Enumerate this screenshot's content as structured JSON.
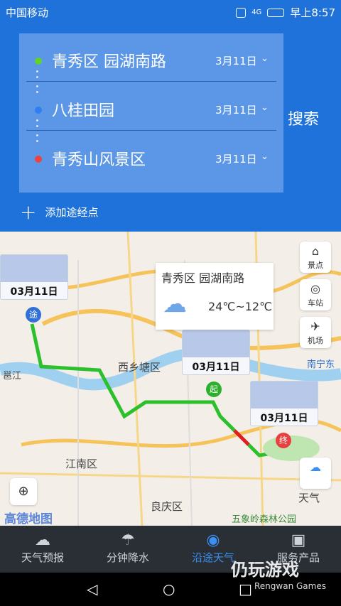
{
  "status_bar": {
    "carrier": "中国移动",
    "signal": "4G",
    "time": "早上8:57"
  },
  "route": [
    {
      "name": "青秀区 园湖南路",
      "date": "3月11日",
      "color": "#5fd32a"
    },
    {
      "name": "八桂田园",
      "date": "3月11日",
      "color": "#2f7ff0"
    },
    {
      "name": "青秀山风景区",
      "date": "3月11日",
      "color": "#f04040"
    }
  ],
  "search_label": "搜索",
  "add_stop_label": "添加途经点",
  "map": {
    "labels": [
      "西乡塘区",
      "江南区",
      "良庆区",
      "南宁东",
      "五象岭森林公园",
      "邕江"
    ],
    "weather_cards": [
      {
        "date": "03月11日"
      },
      {
        "date": "03月11日"
      },
      {
        "date": "03月11日"
      }
    ],
    "popup": {
      "title": "青秀区 园湖南路",
      "temp": "24℃~12℃"
    },
    "markers": {
      "via": "途",
      "start": "起",
      "end": "终"
    },
    "side_buttons": [
      {
        "label": "景点",
        "icon": "temple-icon"
      },
      {
        "label": "车站",
        "icon": "station-icon"
      },
      {
        "label": "机场",
        "icon": "plane-icon"
      }
    ],
    "weather_button_label": "天气",
    "logo": "高德地图"
  },
  "tabs": [
    {
      "label": "天气预报",
      "icon": "cloud-icon",
      "active": false
    },
    {
      "label": "分钟降水",
      "icon": "rain-icon",
      "active": false
    },
    {
      "label": "沿途天气",
      "icon": "location-pin-icon",
      "active": true
    },
    {
      "label": "服务产品",
      "icon": "box-icon",
      "active": false
    }
  ],
  "watermark": {
    "title": "仍玩游戏",
    "subtitle": "Rengwan Games"
  }
}
